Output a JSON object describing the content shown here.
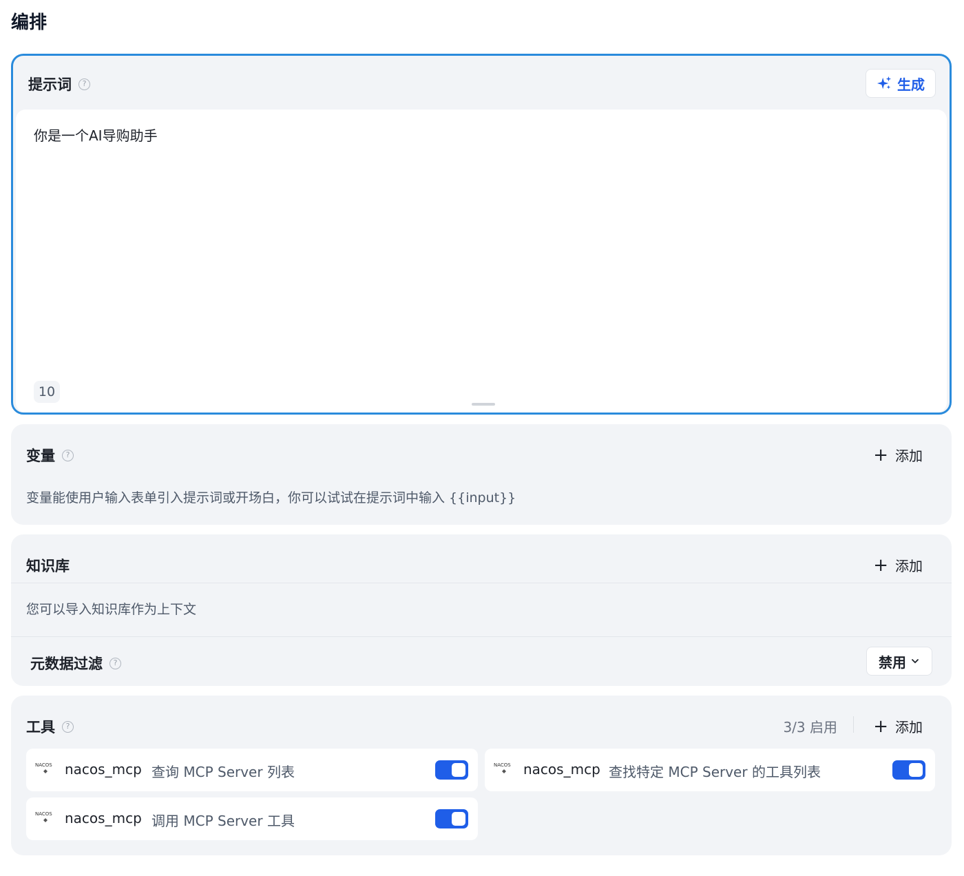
{
  "page": {
    "title": "编排"
  },
  "prompt": {
    "title": "提示词",
    "help": "?",
    "generate_label": "生成",
    "text": "你是一个AI导购助手",
    "char_count": "10"
  },
  "variables": {
    "title": "变量",
    "help": "?",
    "add_label": "添加",
    "description": "变量能使用户输入表单引入提示词或开场白，你可以试试在提示词中输入 {{input}}"
  },
  "knowledge": {
    "title": "知识库",
    "add_label": "添加",
    "description": "您可以导入知识库作为上下文",
    "metadata_filter": {
      "title": "元数据过滤",
      "help": "?",
      "selected": "禁用"
    }
  },
  "tools": {
    "title": "工具",
    "help": "?",
    "count_label": "3/3 启用",
    "add_label": "添加",
    "items": [
      {
        "name": "nacos_mcp",
        "description": "查询 MCP Server 列表",
        "enabled": true
      },
      {
        "name": "nacos_mcp",
        "description": "查找特定 MCP Server 的工具列表",
        "enabled": true
      },
      {
        "name": "nacos_mcp",
        "description": "调用 MCP Server 工具",
        "enabled": true
      }
    ],
    "logo_text": "NACOS"
  },
  "colors": {
    "accent": "#1f5ee8",
    "focus_border": "#2a8bdc",
    "card_bg": "#f2f4f7"
  }
}
